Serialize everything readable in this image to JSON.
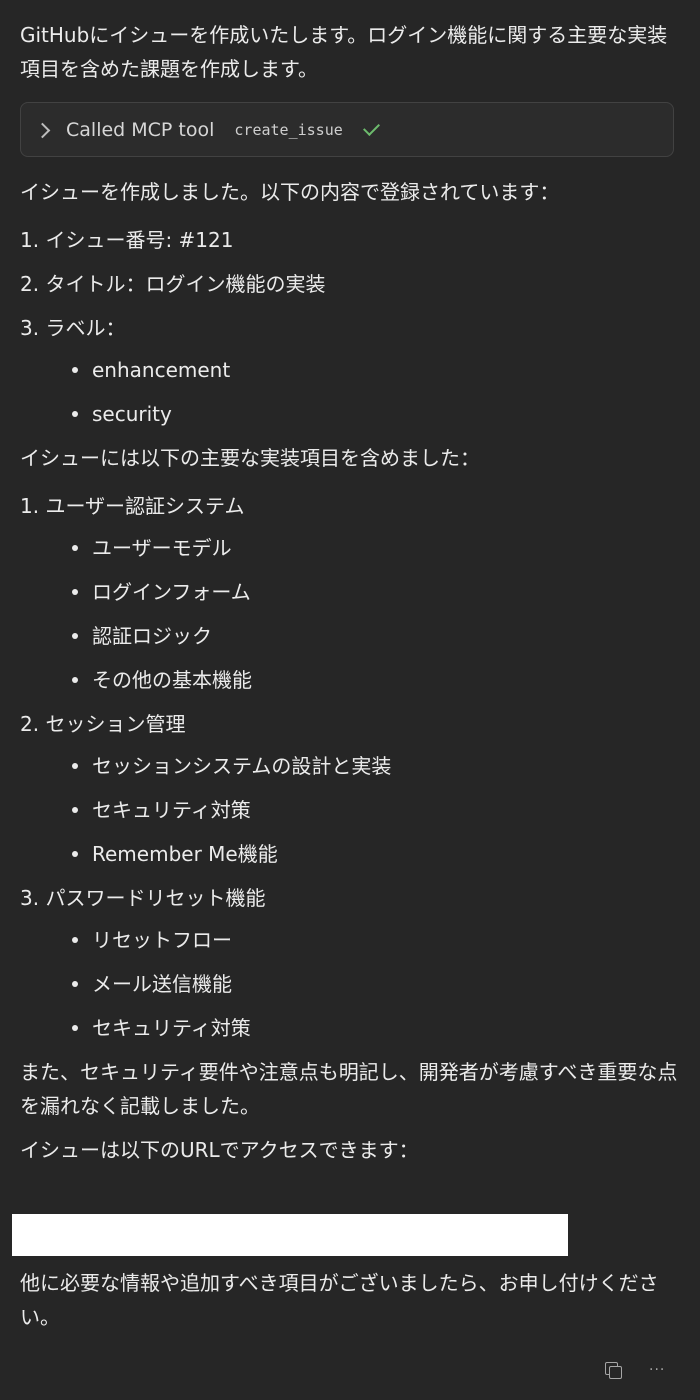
{
  "intro": "GitHubにイシューを作成いたします。ログイン機能に関する主要な実装項目を含めた課題を作成します。",
  "tool_call": {
    "label": "Called MCP tool",
    "name": "create_issue"
  },
  "created_text": "イシューを作成しました。以下の内容で登録されています：",
  "details": [
    "1. イシュー番号: #121",
    "2. タイトル：ログイン機能の実装",
    "3. ラベル："
  ],
  "labels": [
    "enhancement",
    "security"
  ],
  "included_text": "イシューには以下の主要な実装項目を含めました：",
  "sections": [
    {
      "title": "1. ユーザー認証システム",
      "items": [
        "ユーザーモデル",
        "ログインフォーム",
        "認証ロジック",
        "その他の基本機能"
      ]
    },
    {
      "title": "2. セッション管理",
      "items": [
        "セッションシステムの設計と実装",
        "セキュリティ対策",
        "Remember Me機能"
      ]
    },
    {
      "title": "3. パスワードリセット機能",
      "items": [
        "リセットフロー",
        "メール送信機能",
        "セキュリティ対策"
      ]
    }
  ],
  "note": "また、セキュリティ要件や注意点も明記し、開発者が考慮すべき重要な点を漏れなく記載しました。",
  "url_intro": "イシューは以下のURLでアクセスできます：",
  "closing": "他に必要な情報や追加すべき項目がございましたら、お申し付けください。",
  "actions": {
    "copy_icon": "copy-icon",
    "more_icon": "ellipsis-icon",
    "more_glyph": "···"
  }
}
